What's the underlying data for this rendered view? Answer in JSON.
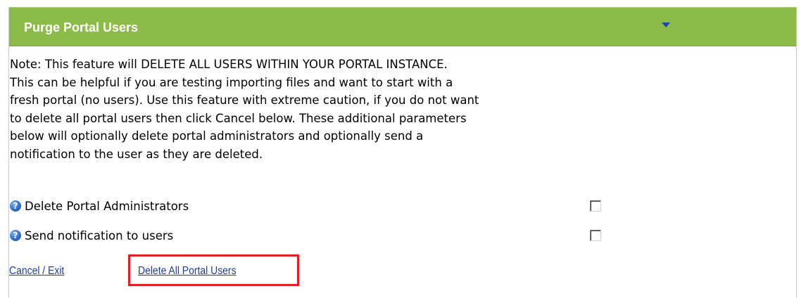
{
  "panel": {
    "title": "Purge Portal Users",
    "collapse_icon": "chevron-down-icon",
    "header_color": "#8dbb4a"
  },
  "note": {
    "lines": [
      "Note: This feature will DELETE ALL USERS WITHIN YOUR PORTAL INSTANCE.",
      "This can be helpful if you are testing importing files and want to start with a",
      "fresh portal (no users). Use this feature with extreme caution, if you do not want",
      "to delete all portal users then click Cancel below. These additional parameters",
      "below will optionally delete portal administrators and optionally send a",
      "notification to the user as they are deleted."
    ]
  },
  "options": [
    {
      "label": "Delete Portal Administrators",
      "icon": "help-icon",
      "checked": false
    },
    {
      "label": "Send notification to users",
      "icon": "help-icon",
      "checked": false
    }
  ],
  "actions": {
    "cancel_label": "Cancel / Exit",
    "delete_label": "Delete All Portal Users",
    "link_color": "#1a3c9e",
    "highlight_color": "#e21f26"
  }
}
